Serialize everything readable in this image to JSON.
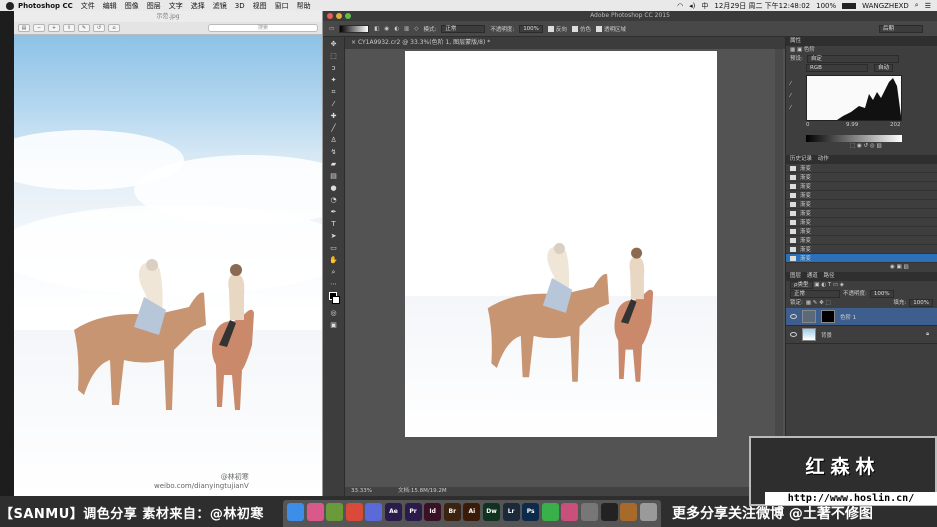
{
  "menubar": {
    "app_name": "Photoshop CC",
    "items": [
      "文件",
      "编辑",
      "图像",
      "图层",
      "文字",
      "选择",
      "滤镜",
      "3D",
      "视图",
      "窗口",
      "帮助"
    ],
    "ime": "中",
    "datetime": "12月29日 周二 下午12:48:02",
    "battery": "100%",
    "user": "WANGZHEXD"
  },
  "preview": {
    "title": "示范.jpg",
    "search_placeholder": "搜索",
    "watermark_line1": "@林初寒",
    "watermark_line2": "weibo.com/dianyingtujianV"
  },
  "photoshop": {
    "window_title": "Adobe Photoshop CC 2015",
    "options": {
      "mode_label": "模式:",
      "mode_value": "正常",
      "opacity_label": "不透明度:",
      "opacity_value": "100%",
      "reverse_label": "反向",
      "dither_label": "仿色",
      "transparency_label": "透明区域",
      "workspace": "后期"
    },
    "doc_tab": "CY1A9932.cr2 @ 33.3%(色阶 1, 图层蒙版/8) *",
    "status": {
      "zoom": "33.33%",
      "doc_size": "文档:15.8M/19.2M"
    },
    "properties": {
      "title": "属性",
      "panel_type": "色阶",
      "preset_label": "预设:",
      "preset_value": "自定",
      "channel": "RGB",
      "auto_label": "自动",
      "input_values": [
        "0",
        "9.99",
        "202"
      ]
    },
    "history": {
      "tabs": [
        "历史记录",
        "动作"
      ],
      "items": [
        "渐变",
        "渐变",
        "渐变",
        "渐变",
        "渐变",
        "渐变",
        "渐变",
        "渐变",
        "渐变",
        "渐变",
        "渐变"
      ]
    },
    "layers": {
      "tabs": [
        "图层",
        "通道",
        "路径"
      ],
      "kind_label": "ρ类型",
      "blend_mode": "正常",
      "opacity_label": "不透明度:",
      "opacity_value": "100%",
      "lock_label": "锁定:",
      "fill_label": "填充:",
      "fill_value": "100%",
      "items": [
        {
          "name": "色阶 1",
          "selected": true
        },
        {
          "name": "背景",
          "selected": false
        }
      ]
    }
  },
  "dock": {
    "apps": [
      {
        "icon": "finder-icon",
        "label": "",
        "color": "#3d8ee8"
      },
      {
        "icon": "launchpad-icon",
        "label": "",
        "color": "#d95a8a"
      },
      {
        "icon": "photos-icon",
        "label": "",
        "color": "#6a9a3a"
      },
      {
        "icon": "chrome-icon",
        "label": "",
        "color": "#d94a3a"
      },
      {
        "icon": "thunder-icon",
        "label": "",
        "color": "#5a6ad8"
      },
      {
        "icon": "after-effects-icon",
        "label": "Ae",
        "color": "#2a1b4a"
      },
      {
        "icon": "premiere-icon",
        "label": "Pr",
        "color": "#2a1b4a"
      },
      {
        "icon": "indesign-icon",
        "label": "Id",
        "color": "#3a1024"
      },
      {
        "icon": "bridge-icon",
        "label": "Br",
        "color": "#3a2410"
      },
      {
        "icon": "illustrator-icon",
        "label": "Ai",
        "color": "#3a1a08"
      },
      {
        "icon": "dreamweaver-icon",
        "label": "Dw",
        "color": "#0f3320"
      },
      {
        "icon": "lightroom-icon",
        "label": "Lr",
        "color": "#1a2a3a"
      },
      {
        "icon": "photoshop-icon",
        "label": "Ps",
        "color": "#0e2a4a"
      },
      {
        "icon": "wechat-icon",
        "label": "",
        "color": "#3ab04a"
      },
      {
        "icon": "colorsync-icon",
        "label": "",
        "color": "#c8507a"
      },
      {
        "icon": "image-capture-icon",
        "label": "",
        "color": "#777777"
      },
      {
        "icon": "qq-icon",
        "label": "",
        "color": "#222222"
      },
      {
        "icon": "toolbox-icon",
        "label": "",
        "color": "#a86a2a"
      },
      {
        "icon": "trash-icon",
        "label": "",
        "color": "#9a9a9a"
      }
    ]
  },
  "captions": {
    "left": "【SANMU】调色分享  素材来自：@林初寒",
    "right": "更多分享关注微博 @土著不修图"
  },
  "brand": {
    "name": "红森林",
    "url": "http://www.hoslin.cn/"
  }
}
